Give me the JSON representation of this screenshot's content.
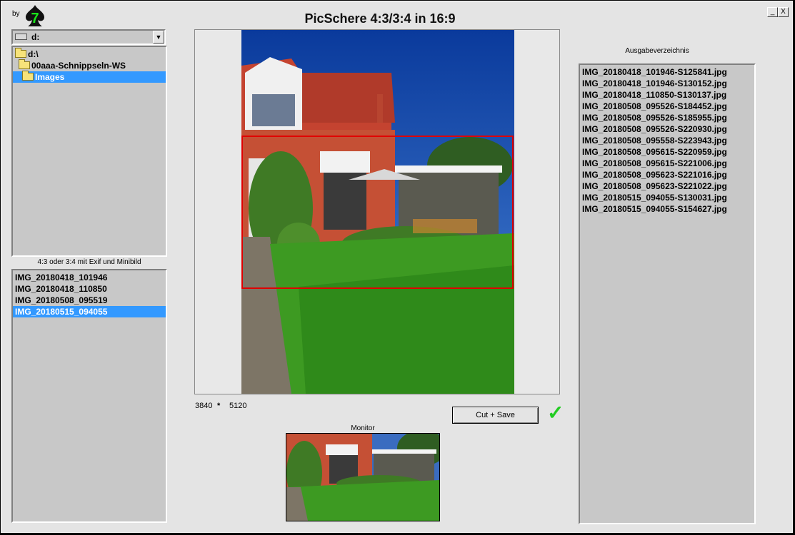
{
  "app": {
    "by_label": "by",
    "title": "PicSchere 4:3/3:4 in 16:9",
    "minimize": "_",
    "close": "X",
    "logo_digit": "7"
  },
  "drive": {
    "value": "d:",
    "arrow": "▼"
  },
  "folders": [
    {
      "label": "d:\\",
      "selected": false
    },
    {
      "label": "00aaa-Schnippseln-WS",
      "selected": false
    },
    {
      "label": "Images",
      "selected": true
    }
  ],
  "files_label": "4:3 oder 3:4 mit Exif und Minibild",
  "files": [
    {
      "label": "IMG_20180418_101946",
      "selected": false
    },
    {
      "label": "IMG_20180418_110850",
      "selected": false
    },
    {
      "label": "IMG_20180508_095519",
      "selected": false
    },
    {
      "label": "IMG_20180515_094055",
      "selected": true
    }
  ],
  "image_info": {
    "width": "3840",
    "separator": "*",
    "height": "5120"
  },
  "cut_save_label": "Cut + Save",
  "checkmark": "✓",
  "monitor_label": "Monitor",
  "output": {
    "label": "Ausgabeverzeichnis",
    "files": [
      "IMG_20180418_101946-S125841.jpg",
      "IMG_20180418_101946-S130152.jpg",
      "IMG_20180418_110850-S130137.jpg",
      "IMG_20180508_095526-S184452.jpg",
      "IMG_20180508_095526-S185955.jpg",
      "IMG_20180508_095526-S220930.jpg",
      "IMG_20180508_095558-S223943.jpg",
      "IMG_20180508_095615-S220959.jpg",
      "IMG_20180508_095615-S221006.jpg",
      "IMG_20180508_095623-S221016.jpg",
      "IMG_20180508_095623-S221022.jpg",
      "IMG_20180515_094055-S130031.jpg",
      "IMG_20180515_094055-S154627.jpg"
    ]
  },
  "colors": {
    "selection": "#3399ff",
    "crop_frame": "#e00000",
    "checkmark": "#22cc22",
    "list_bg": "#c8c8c8"
  }
}
